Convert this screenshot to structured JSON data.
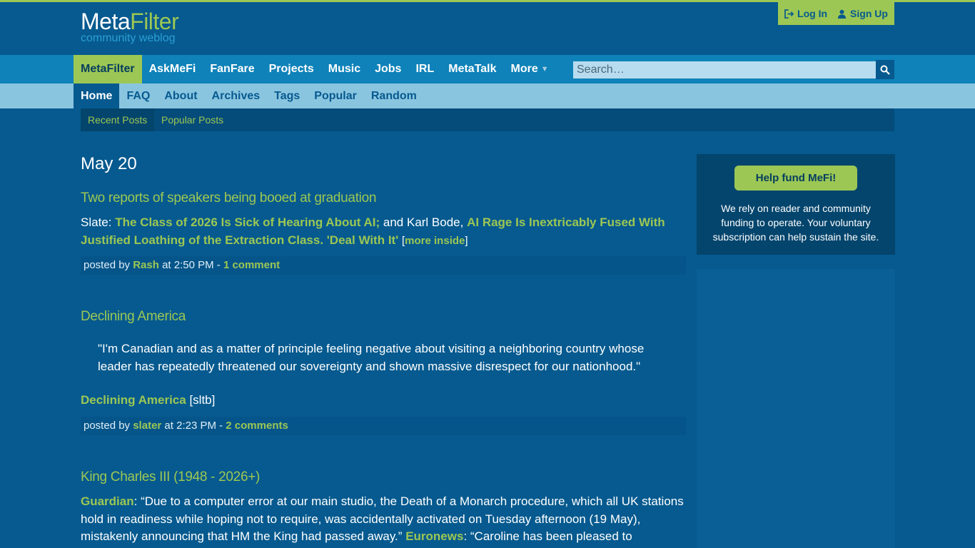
{
  "colors": {
    "accent": "#9cc754",
    "background": "#065a8f",
    "navbar": "#0e82b9",
    "subnav": "#8ac5e0"
  },
  "header": {
    "logo_meta": "Meta",
    "logo_filter": "Filter",
    "tagline": "community weblog",
    "login": "Log In",
    "signup": "Sign Up"
  },
  "nav": {
    "items": [
      "MetaFilter",
      "AskMeFi",
      "FanFare",
      "Projects",
      "Music",
      "Jobs",
      "IRL",
      "MetaTalk",
      "More"
    ],
    "search_placeholder": "Search…"
  },
  "subnav": {
    "items": [
      "Home",
      "FAQ",
      "About",
      "Archives",
      "Tags",
      "Popular",
      "Random"
    ]
  },
  "tabs": [
    "Recent Posts",
    "Popular Posts"
  ],
  "date_heading": "May 20",
  "posts": [
    {
      "title": "Two reports of speakers being booed at graduation",
      "source1": "Slate:",
      "link1": "The Class of 2026 Is Sick of Hearing About AI;",
      "text1": "and Karl Bode,",
      "link2": "AI Rage Is Inextricably Fused With Justified Loathing of the Extraction Class. 'Deal With It'",
      "more_inside": "more inside",
      "posted_by": "posted by",
      "author": "Rash",
      "time": "at 2:50 PM -",
      "comments": "1 comment"
    },
    {
      "title": "Declining America",
      "quote": "\"I'm Canadian and as a matter of principle feeling negative about visiting a neighboring country whose leader has repeatedly threatened our sovereignty and shown massive disrespect for our nationhood.\"",
      "link1": "Declining America",
      "suffix": "[sltb]",
      "posted_by": "posted by",
      "author": "slater",
      "time": "at 2:23 PM -",
      "comments": "2 comments"
    },
    {
      "title": "King Charles III (1948 - 2026+)",
      "link1": "Guardian",
      "text1": ": “Due to a computer error at our main studio, the Death of a Monarch procedure, which all UK stations hold in readiness while hoping not to require, was accidentally activated on Tuesday afternoon (19 May), mistakenly announcing that HM the King had passed away.”",
      "link2": "Euronews",
      "text2": ": “Caroline has been pleased to"
    }
  ],
  "sidebar": {
    "fund_button": "Help fund MeFi!",
    "fund_text": "We rely on reader and community funding to operate. Your voluntary subscription can help sustain the site."
  }
}
